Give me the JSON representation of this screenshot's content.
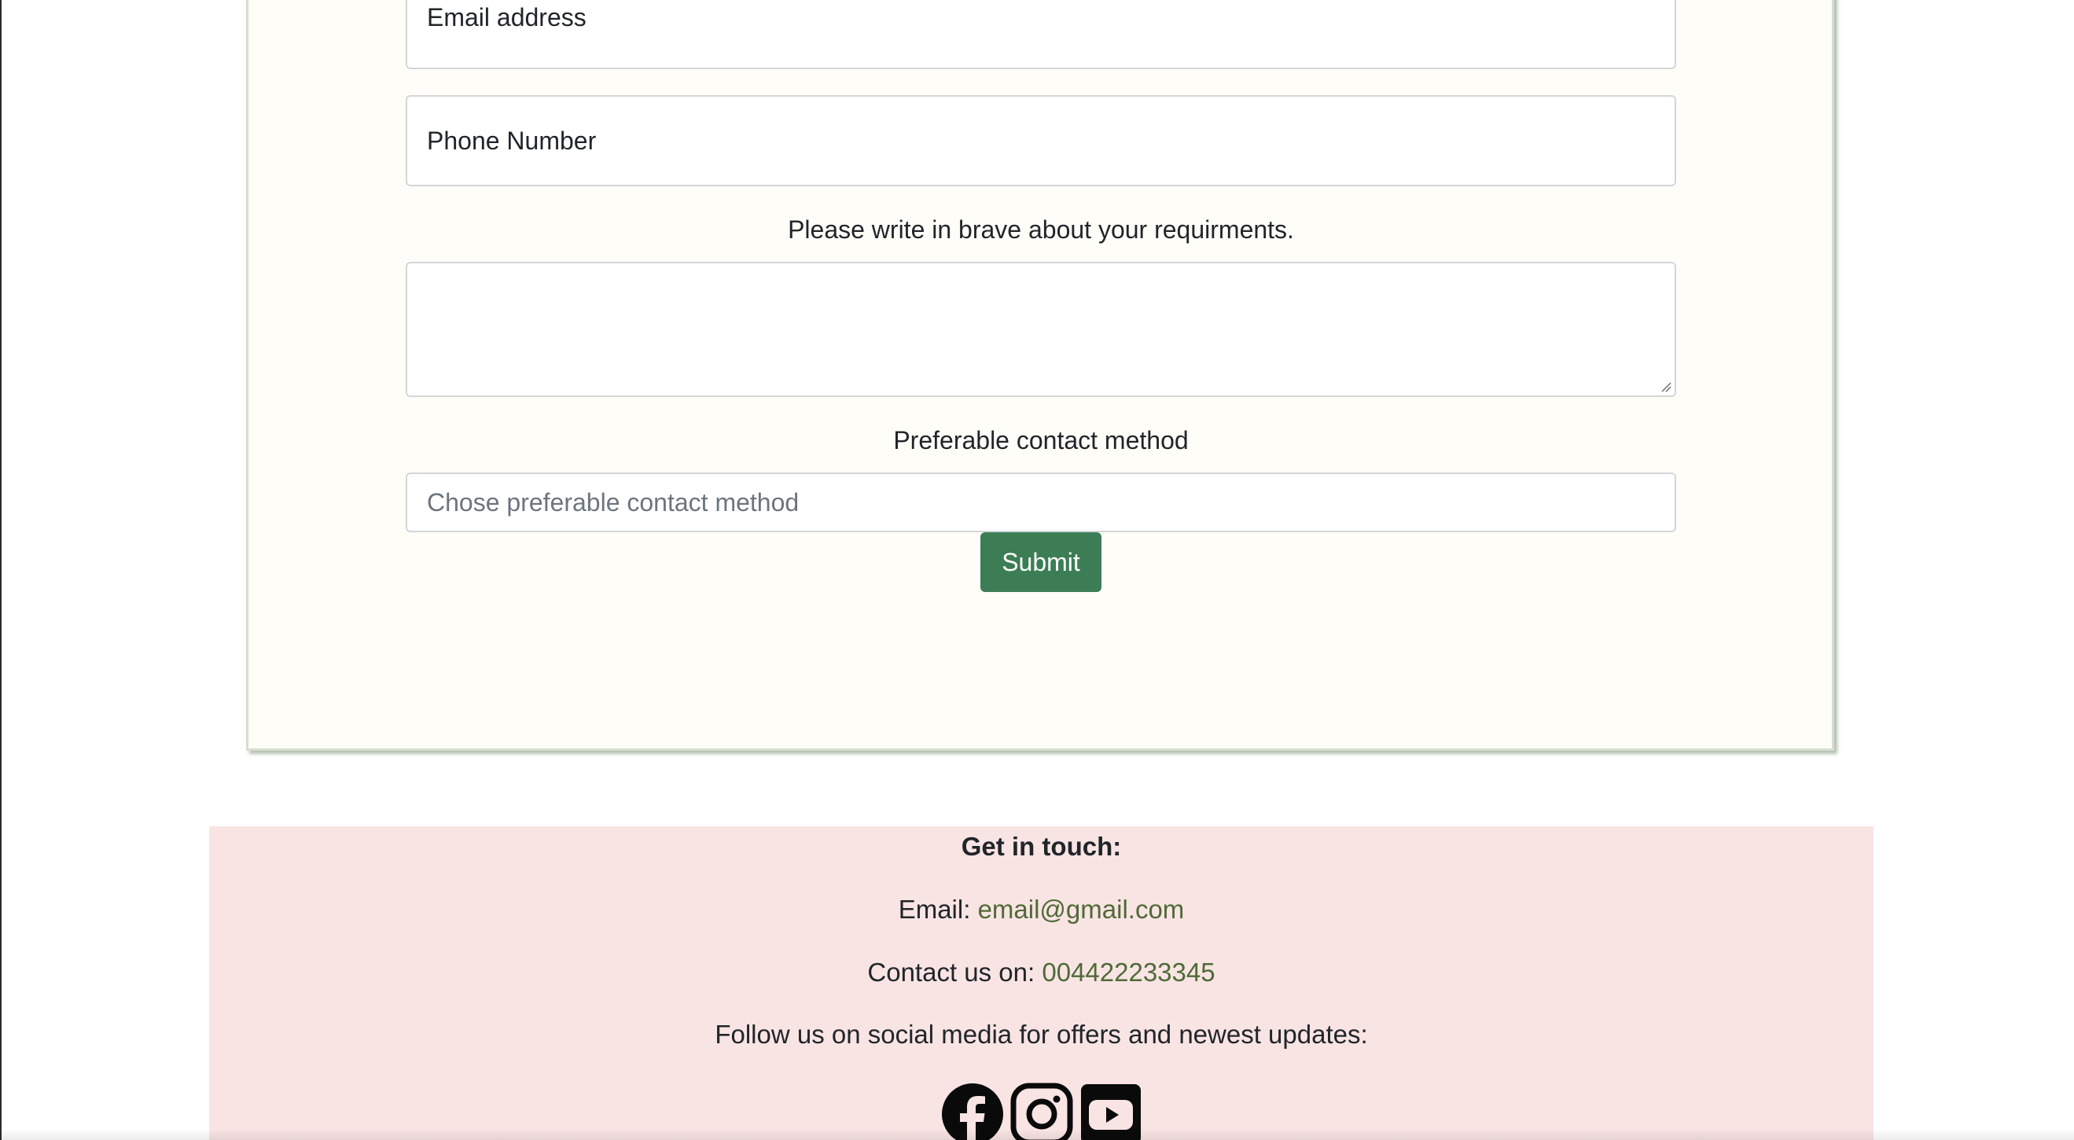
{
  "form": {
    "email_placeholder": "Email address",
    "phone_placeholder": "Phone Number",
    "requirements_label": "Please write in brave about your requirments.",
    "requirements_value": "",
    "contact_method_label": "Preferable contact method",
    "contact_method_placeholder": "Chose preferable contact method",
    "submit_label": "Submit"
  },
  "footer": {
    "title": "Get in touch:",
    "email_label": "Email: ",
    "email_value": "email@gmail.com",
    "phone_label": "Contact us on: ",
    "phone_value": "004422233345",
    "follow_text": "Follow us on social media for offers and newest updates:",
    "social_icons": [
      "facebook-icon",
      "instagram-icon",
      "youtube-icon"
    ]
  },
  "colors": {
    "card_background": "#fffdf8",
    "footer_background": "#f9e4e4",
    "submit_button": "#3c7d55",
    "link": "#4f6a37"
  }
}
